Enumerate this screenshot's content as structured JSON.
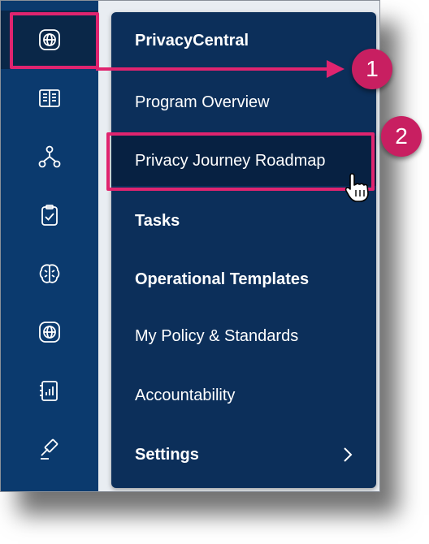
{
  "sidebar": {
    "icons": [
      {
        "name": "globe-icon",
        "active": true
      },
      {
        "name": "book-icon",
        "active": false
      },
      {
        "name": "hierarchy-icon",
        "active": false
      },
      {
        "name": "clipboard-check-icon",
        "active": false
      },
      {
        "name": "brain-icon",
        "active": false
      },
      {
        "name": "globe-icon",
        "active": false
      },
      {
        "name": "report-icon",
        "active": false
      },
      {
        "name": "gavel-icon",
        "active": false
      }
    ]
  },
  "menu": {
    "title": "PrivacyCentral",
    "items": [
      {
        "label": "Program Overview"
      },
      {
        "label": "Privacy Journey Roadmap"
      },
      {
        "label": "Tasks"
      },
      {
        "label": "Operational Templates"
      },
      {
        "label": "My Policy & Standards"
      },
      {
        "label": "Accountability"
      },
      {
        "label": "Settings"
      }
    ]
  },
  "annotations": {
    "step1": "1",
    "step2": "2"
  },
  "colors": {
    "rail": "#0b3a6e",
    "panel": "#0c2f5a",
    "highlight": "#e0246f",
    "badge": "#c81f61"
  }
}
